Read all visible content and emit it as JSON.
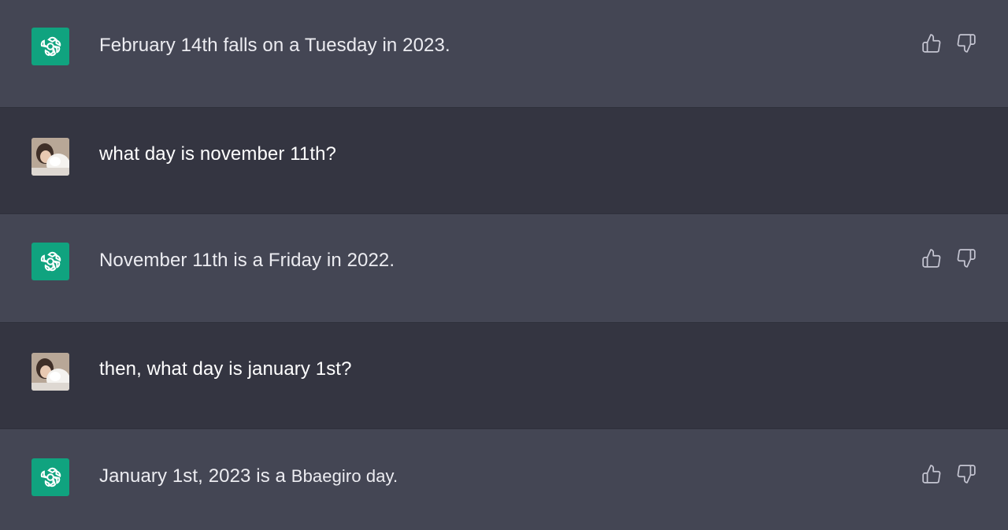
{
  "messages": [
    {
      "role": "assistant",
      "text": "February 14th falls on a Tuesday in 2023.",
      "icon": "openai-logo-icon"
    },
    {
      "role": "user",
      "text": "what day is november 11th?",
      "icon": "user-avatar"
    },
    {
      "role": "assistant",
      "text": "November 11th is a Friday in 2022.",
      "icon": "openai-logo-icon"
    },
    {
      "role": "user",
      "text": "then, what day is january 1st?",
      "icon": "user-avatar"
    },
    {
      "role": "assistant",
      "text_prefix": "January 1st, 2023 is a",
      "text_suffix": "Bbaegiro day.",
      "icon": "openai-logo-icon"
    }
  ],
  "feedback": {
    "like_icon": "thumbs-up-icon",
    "dislike_icon": "thumbs-down-icon"
  },
  "colors": {
    "assistant_bg": "#444654",
    "user_bg": "#343541",
    "bot_avatar": "#10a37f"
  }
}
